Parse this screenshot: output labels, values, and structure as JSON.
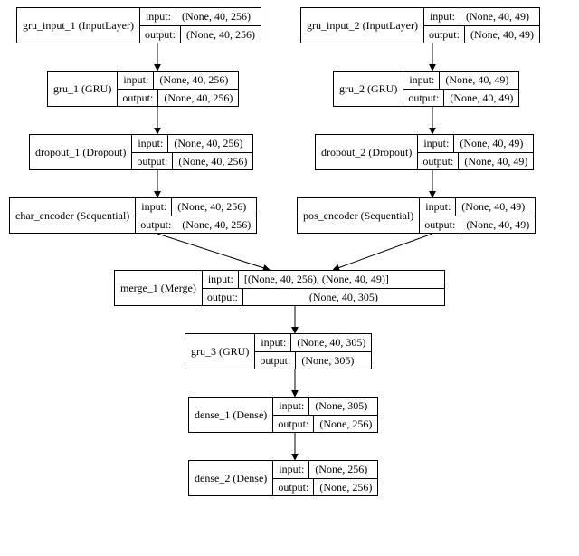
{
  "labels": {
    "input": "input:",
    "output": "output:"
  },
  "nodes": {
    "gru_input_1": {
      "name": "gru_input_1 (InputLayer)",
      "in": "(None, 40, 256)",
      "out": "(None, 40, 256)"
    },
    "gru_input_2": {
      "name": "gru_input_2 (InputLayer)",
      "in": "(None, 40, 49)",
      "out": "(None, 40, 49)"
    },
    "gru_1": {
      "name": "gru_1 (GRU)",
      "in": "(None, 40, 256)",
      "out": "(None, 40, 256)"
    },
    "gru_2": {
      "name": "gru_2 (GRU)",
      "in": "(None, 40, 49)",
      "out": "(None, 40, 49)"
    },
    "dropout_1": {
      "name": "dropout_1 (Dropout)",
      "in": "(None, 40, 256)",
      "out": "(None, 40, 256)"
    },
    "dropout_2": {
      "name": "dropout_2 (Dropout)",
      "in": "(None, 40, 49)",
      "out": "(None, 40, 49)"
    },
    "char_enc": {
      "name": "char_encoder (Sequential)",
      "in": "(None, 40, 256)",
      "out": "(None, 40, 256)"
    },
    "pos_enc": {
      "name": "pos_encoder (Sequential)",
      "in": "(None, 40, 49)",
      "out": "(None, 40, 49)"
    },
    "merge_1": {
      "name": "merge_1 (Merge)",
      "in": "[(None, 40, 256), (None, 40, 49)]",
      "out": "(None, 40, 305)"
    },
    "gru_3": {
      "name": "gru_3 (GRU)",
      "in": "(None, 40, 305)",
      "out": "(None, 305)"
    },
    "dense_1": {
      "name": "dense_1 (Dense)",
      "in": "(None, 305)",
      "out": "(None, 256)"
    },
    "dense_2": {
      "name": "dense_2 (Dense)",
      "in": "(None, 256)",
      "out": "(None, 256)"
    }
  }
}
